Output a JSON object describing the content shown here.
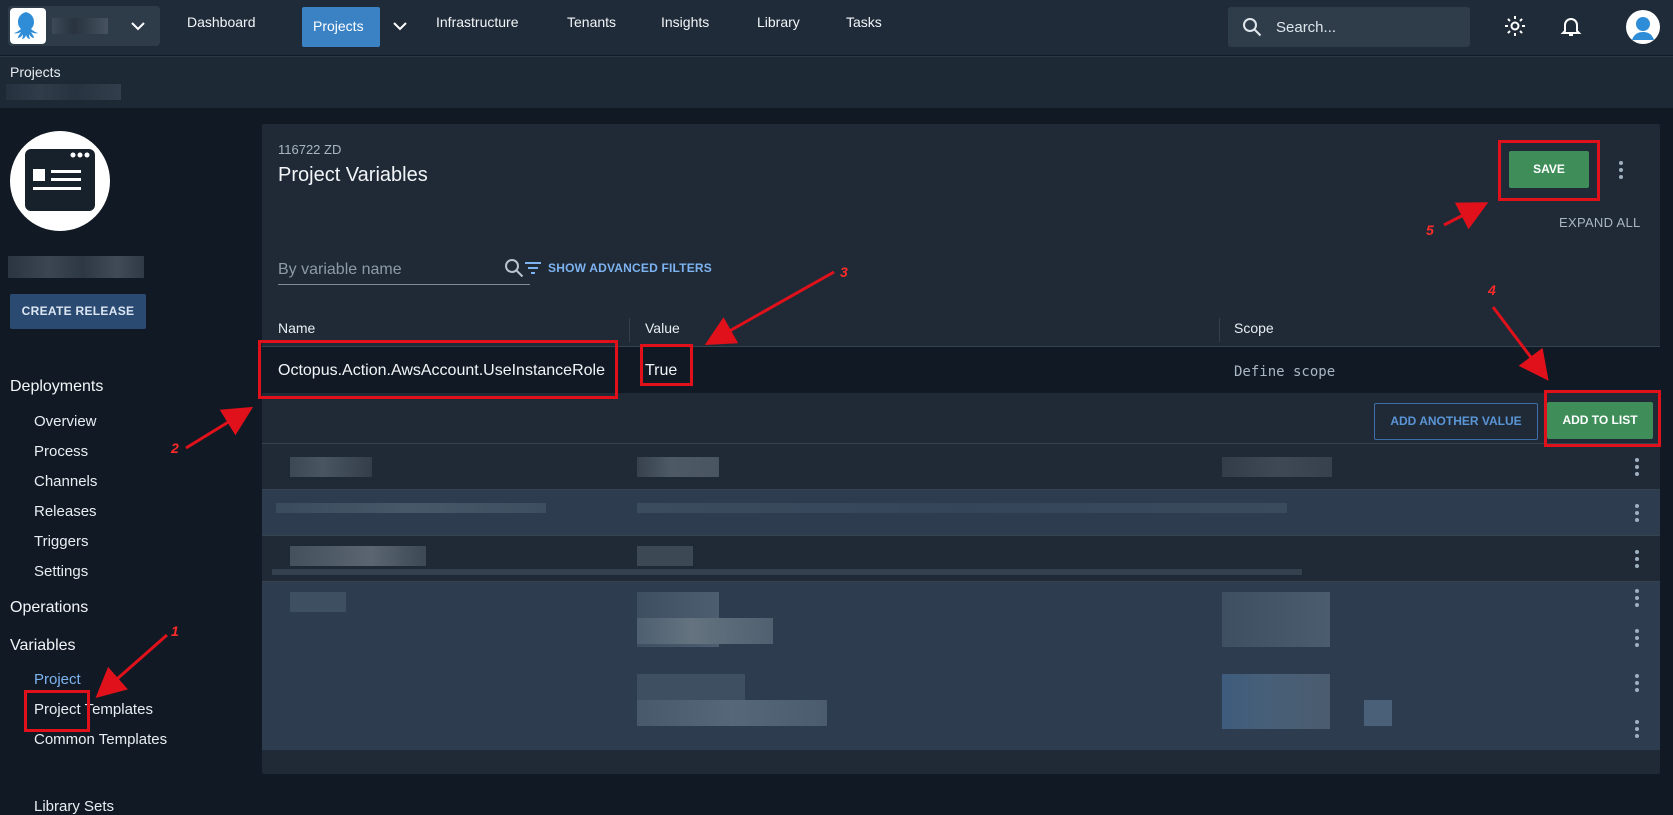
{
  "topbar": {
    "nav": [
      "Dashboard",
      "Projects",
      "Infrastructure",
      "Tenants",
      "Insights",
      "Library",
      "Tasks"
    ],
    "search_placeholder": "Search..."
  },
  "breadcrumb": "Projects",
  "sidebar": {
    "create_release": "CREATE RELEASE",
    "deployments_title": "Deployments",
    "deployments": [
      "Overview",
      "Process",
      "Channels",
      "Releases",
      "Triggers",
      "Settings"
    ],
    "operations_title": "Operations",
    "variables_title": "Variables",
    "variables": [
      "Project",
      "Project Templates",
      "Common Templates",
      "Library Sets"
    ]
  },
  "panel": {
    "subtitle": "116722 ZD",
    "title": "Project Variables",
    "save": "SAVE",
    "expand_all": "EXPAND ALL",
    "filter_placeholder": "By variable name",
    "advanced_filters": "SHOW ADVANCED FILTERS",
    "columns": [
      "Name",
      "Value",
      "Scope"
    ],
    "edit_row": {
      "name": "Octopus.Action.AwsAccount.UseInstanceRole",
      "value": "True",
      "scope_placeholder": "Define scope"
    },
    "add_another": "ADD ANOTHER VALUE",
    "add_to_list": "ADD TO LIST"
  },
  "annotations": [
    "1",
    "2",
    "3",
    "4",
    "5"
  ],
  "colors": {
    "accent": "#3b82c4",
    "success": "#3f8e5a",
    "annotation": "#e0111b"
  }
}
